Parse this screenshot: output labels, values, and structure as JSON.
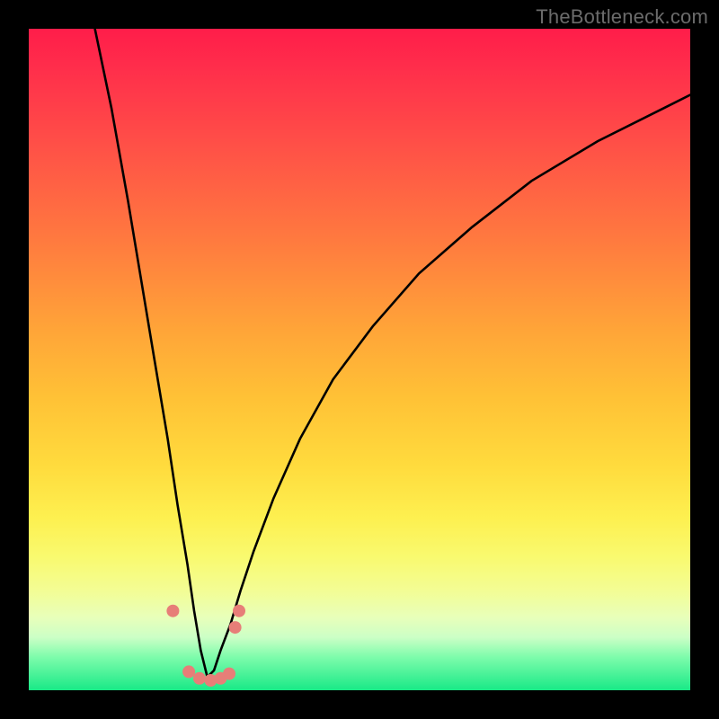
{
  "watermark": "TheBottleneck.com",
  "chart_data": {
    "type": "line",
    "title": "",
    "xlabel": "",
    "ylabel": "",
    "xlim": [
      0,
      100
    ],
    "ylim": [
      0,
      100
    ],
    "grid": false,
    "legend": false,
    "notes": "No numeric axis ticks or labels are visible in the image; x and y are normalized 0–100. Curve is a V-shaped bottleneck profile with minimum near x≈27. Scatter points are small salmon-colored markers clustered near the trough.",
    "series": [
      {
        "name": "bottleneck-curve",
        "color": "#000000",
        "x": [
          10,
          12.5,
          15,
          17,
          19,
          21,
          22.5,
          24,
          25,
          26,
          27,
          28,
          29,
          30.5,
          32,
          34,
          37,
          41,
          46,
          52,
          59,
          67,
          76,
          86,
          96,
          100
        ],
        "values": [
          100,
          88,
          74,
          62,
          50,
          38,
          28,
          19,
          12,
          6,
          2,
          3,
          6,
          10,
          15,
          21,
          29,
          38,
          47,
          55,
          63,
          70,
          77,
          83,
          88,
          90
        ]
      }
    ],
    "scatter": {
      "name": "highlight-points",
      "color": "#e77e78",
      "radius_px": 7,
      "points": [
        {
          "x": 21.8,
          "y": 12.0
        },
        {
          "x": 24.2,
          "y": 2.8
        },
        {
          "x": 25.8,
          "y": 1.8
        },
        {
          "x": 27.5,
          "y": 1.5
        },
        {
          "x": 29.0,
          "y": 1.8
        },
        {
          "x": 30.3,
          "y": 2.5
        },
        {
          "x": 31.2,
          "y": 9.5
        },
        {
          "x": 31.8,
          "y": 12.0
        }
      ]
    },
    "background_gradient": {
      "orientation": "vertical",
      "stops": [
        {
          "pos": 0.0,
          "hex": "#ff1d4a"
        },
        {
          "pos": 0.32,
          "hex": "#ff7a3f"
        },
        {
          "pos": 0.66,
          "hex": "#ffdb3d"
        },
        {
          "pos": 0.85,
          "hex": "#f3fd95"
        },
        {
          "pos": 1.0,
          "hex": "#19e987"
        }
      ]
    }
  }
}
